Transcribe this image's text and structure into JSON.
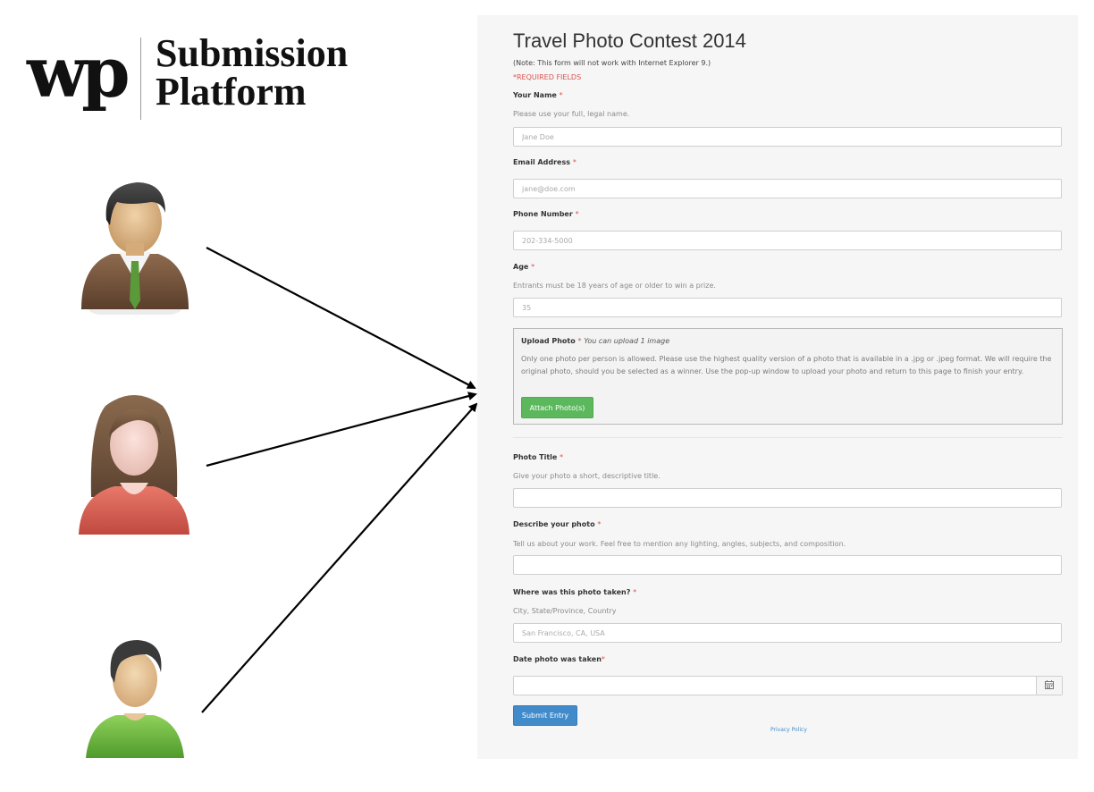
{
  "brand": {
    "logo": "wp",
    "title_line1": "Submission",
    "title_line2": "Platform"
  },
  "icons": {
    "avatar_man": "man-in-suit-avatar-icon",
    "avatar_woman": "woman-avatar-icon",
    "avatar_boy": "boy-green-shirt-avatar-icon",
    "arrow": "arrow-icon",
    "calendar": "calendar-icon"
  },
  "colors": {
    "required": "#d9534f",
    "attach_button": "#5cb85c",
    "submit_button": "#428bca",
    "panel_bg": "#f6f6f6"
  },
  "form": {
    "title": "Travel Photo Contest 2014",
    "note": "(Note: This form will not work with Internet Explorer 9.)",
    "required_note": "*REQUIRED FIELDS",
    "required_mark": "*",
    "name": {
      "label": "Your Name",
      "help": "Please use your full, legal name.",
      "placeholder": "Jane Doe"
    },
    "email": {
      "label": "Email Address",
      "placeholder": "jane@doe.com"
    },
    "phone": {
      "label": "Phone Number",
      "placeholder": "202-334-5000"
    },
    "age": {
      "label": "Age",
      "help": "Entrants must be 18 years of age or older to win a prize.",
      "placeholder": "35"
    },
    "upload": {
      "label": "Upload Photo",
      "hint": "You can upload 1 image",
      "description": "Only one photo per person is allowed. Please use the highest quality version of a photo that is available in a .jpg or .jpeg format. We will require the original photo, should you be selected as a winner. Use the pop-up window to upload your photo and return to this page to finish your entry.",
      "button": "Attach Photo(s)"
    },
    "photo_title": {
      "label": "Photo Title",
      "help": "Give your photo a short, descriptive title.",
      "value": ""
    },
    "describe": {
      "label": "Describe your photo",
      "help": "Tell us about your work. Feel free to mention any lighting, angles, subjects, and composition.",
      "value": ""
    },
    "location": {
      "label": "Where was this photo taken?",
      "help": "City, State/Province, Country",
      "placeholder": "San Francisco, CA, USA"
    },
    "date": {
      "label": "Date photo was taken",
      "value": ""
    },
    "submit": "Submit Entry",
    "privacy": "Privacy Policy"
  }
}
